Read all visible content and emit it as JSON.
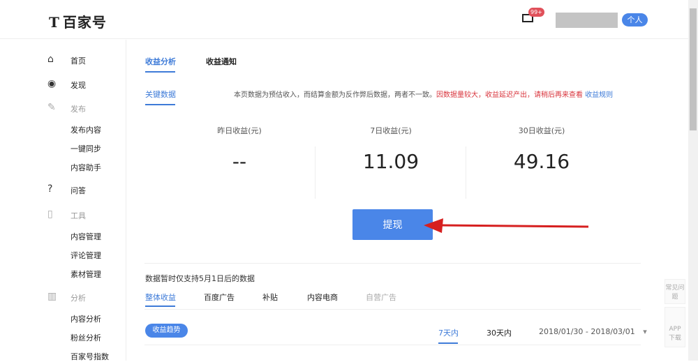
{
  "header": {
    "logo_mark": "T",
    "logo_text": "百家号",
    "mail_badge": "99+",
    "personal_label": "个人"
  },
  "sidebar": {
    "items": [
      {
        "label": "首页",
        "icon": "home-icon",
        "type": "main"
      },
      {
        "label": "发现",
        "icon": "eye-icon",
        "type": "main"
      },
      {
        "label": "发布",
        "icon": "edit-icon",
        "type": "group"
      },
      {
        "label": "发布内容",
        "type": "sub"
      },
      {
        "label": "一键同步",
        "type": "sub"
      },
      {
        "label": "内容助手",
        "type": "sub"
      },
      {
        "label": "问答",
        "icon": "question-icon",
        "type": "main"
      },
      {
        "label": "工具",
        "icon": "bag-icon",
        "type": "group"
      },
      {
        "label": "内容管理",
        "type": "sub"
      },
      {
        "label": "评论管理",
        "type": "sub"
      },
      {
        "label": "素材管理",
        "type": "sub"
      },
      {
        "label": "分析",
        "icon": "chart-icon",
        "type": "group"
      },
      {
        "label": "内容分析",
        "type": "sub"
      },
      {
        "label": "粉丝分析",
        "type": "sub"
      },
      {
        "label": "百家号指数",
        "type": "sub"
      }
    ]
  },
  "tabs": {
    "analysis": "收益分析",
    "notice": "收益通知"
  },
  "key_data": {
    "label": "关键数据",
    "notice": "本页数据为预估收入，而结算金额为反作弊后数据，两者不一致。",
    "warning": "因数据量较大，收益延迟产出，请稍后再来查看",
    "rules_link": "收益规则"
  },
  "stats": [
    {
      "label": "昨日收益(元)",
      "value": "--"
    },
    {
      "label": "7日收益(元)",
      "value": "11.09"
    },
    {
      "label": "30日收益(元)",
      "value": "49.16"
    }
  ],
  "withdraw_label": "提现",
  "lower": {
    "note": "数据暂时仅支持5月1日后的数据",
    "tabs": [
      "整体收益",
      "百度广告",
      "补贴",
      "内容电商",
      "自营广告"
    ],
    "trend_label": "收益趋势",
    "ranges": [
      "7天内",
      "30天内"
    ],
    "date_range": "2018/01/30 - 2018/03/01"
  },
  "float": {
    "faq": "常见问题",
    "app": "APP 下载"
  },
  "colors": {
    "accent": "#4a86e8",
    "warning": "#d9363e"
  }
}
